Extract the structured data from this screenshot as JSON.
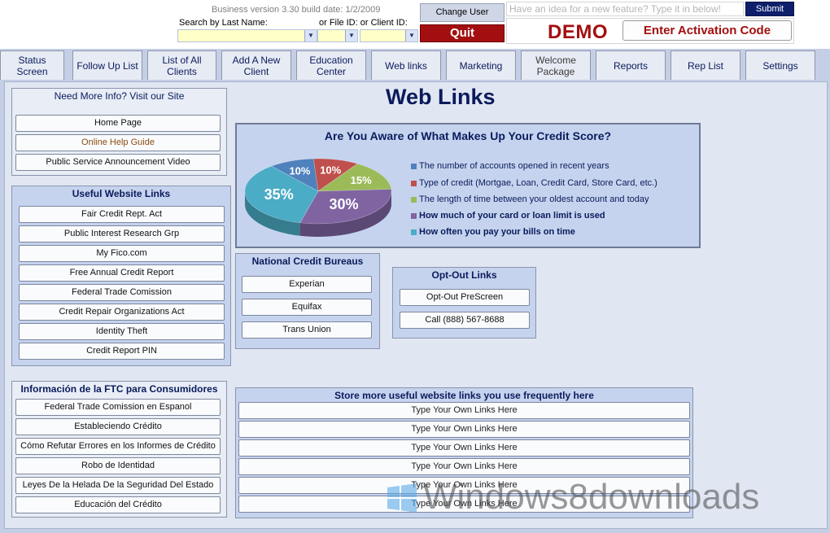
{
  "header": {
    "version": "Business version 3.30  build date: 1/2/2009",
    "search_label": "Search by Last Name:",
    "file_label": "or File ID:  or Client ID:",
    "change_user": "Change User",
    "quit": "Quit",
    "idea_placeholder": "Have an idea for a new feature? Type it in below!",
    "submit": "Submit",
    "demo": "DEMO",
    "activate": "Enter Activation Code"
  },
  "nav": {
    "tabs": [
      {
        "label": "Status\nScreen"
      },
      {
        "label": "Follow Up List"
      },
      {
        "label": "List of All\nClients"
      },
      {
        "label": "Add A New\nClient"
      },
      {
        "label": "Education\nCenter"
      },
      {
        "label": "Web links"
      },
      {
        "label": "Marketing"
      },
      {
        "label": "Welcome\nPackage"
      },
      {
        "label": "Reports"
      },
      {
        "label": "Rep List"
      },
      {
        "label": "Settings"
      }
    ]
  },
  "page": {
    "title": "Web Links"
  },
  "more_info": {
    "title": "Need More Info? Visit our Site",
    "items": [
      "Home Page",
      "Online Help Guide",
      "Public Service Announcement Video"
    ]
  },
  "useful_links": {
    "title": "Useful Website Links",
    "items": [
      "Fair Credit Rept. Act",
      "Public Interest Research Grp",
      "My Fico.com",
      "Free Annual Credit Report",
      "Federal Trade Comission",
      "Credit Repair Organizations Act",
      "Identity Theft",
      "Credit Report PIN"
    ]
  },
  "ftc_spanish": {
    "title": "Información de la FTC para Consumidores",
    "items": [
      "Federal Trade Comission en Espanol",
      "Estableciendo Crédito",
      "Cómo Refutar Errores en los Informes de Crédito",
      "Robo de Identidad",
      "Leyes De la Helada De la Seguridad Del Estado",
      "Educación del Crédito"
    ]
  },
  "credit_score": {
    "title": "Are You Aware of What Makes Up Your Credit Score?",
    "legend": [
      {
        "text": "The number of accounts opened in recent years",
        "color": "#4f81bd"
      },
      {
        "text": "Type of credit (Mortgae, Loan, Credit Card, Store Card, etc.)",
        "color": "#c0504d"
      },
      {
        "text": "The length of time between your oldest account and today",
        "color": "#9bbb59"
      },
      {
        "text": "How much of your card or loan limit is used",
        "color": "#8064a2"
      },
      {
        "text": "How often you pay your bills on time",
        "color": "#4bacc6"
      }
    ],
    "slices": [
      {
        "label": "10%",
        "value": 10,
        "color": "#4f81bd"
      },
      {
        "label": "10%",
        "value": 10,
        "color": "#c0504d"
      },
      {
        "label": "15%",
        "value": 15,
        "color": "#9bbb59"
      },
      {
        "label": "30%",
        "value": 30,
        "color": "#8064a2"
      },
      {
        "label": "35%",
        "value": 35,
        "color": "#4bacc6"
      }
    ]
  },
  "chart_data": {
    "type": "pie",
    "title": "Are You Aware of What Makes Up Your Credit Score?",
    "categories": [
      "The number of accounts opened in recent years",
      "Type of credit (Mortgae, Loan, Credit Card, Store Card, etc.)",
      "The length of time between your oldest account and today",
      "How much of your card or loan limit is used",
      "How often you pay your bills on time"
    ],
    "values": [
      10,
      10,
      15,
      30,
      35
    ],
    "legend": "right"
  },
  "bureaus": {
    "title": "National Credit Bureaus",
    "items": [
      "Experian",
      "Equifax",
      "Trans Union"
    ]
  },
  "optout": {
    "title": "Opt-Out Links",
    "items": [
      "Opt-Out PreScreen",
      "Call (888) 567-8688"
    ]
  },
  "custom_links": {
    "title": "Store more useful website links you use frequently here",
    "items": [
      "Type Your Own Links Here",
      "Type Your Own Links Here",
      "Type Your Own Links Here",
      "Type Your Own Links Here",
      "Type Your Own Links Here",
      "Type Your Own Links Here"
    ]
  },
  "watermark": "Windows8downloads"
}
